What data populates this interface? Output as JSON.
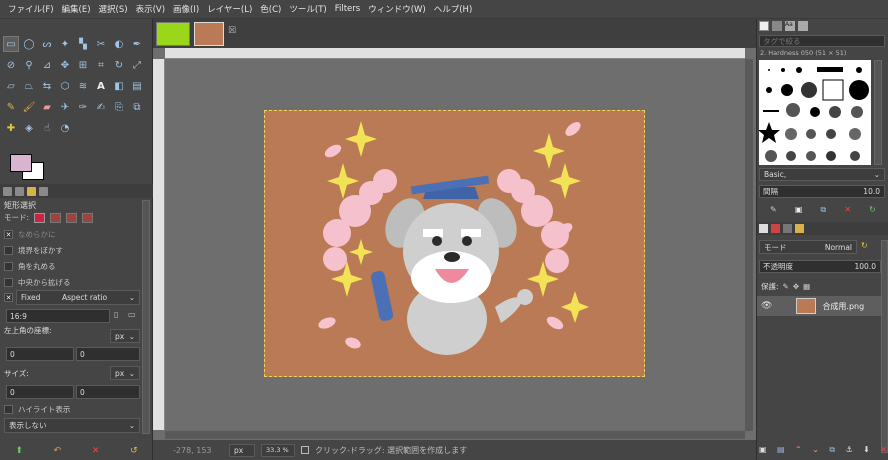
{
  "menu": [
    "ファイル(F)",
    "編集(E)",
    "選択(S)",
    "表示(V)",
    "画像(I)",
    "レイヤー(L)",
    "色(C)",
    "ツール(T)",
    "Filters",
    "ウィンドウ(W)",
    "ヘルプ(H)"
  ],
  "colors": {
    "fg": "#d8b4d0",
    "bg": "#ffffff",
    "image_bg": "#b97a55"
  },
  "tool_options": {
    "title": "矩形選択",
    "mode_label": "モード:",
    "antialias": "なめらかに",
    "feather": "境界をぼかす",
    "rounded": "角を丸める",
    "expand": "中央から拡げる",
    "fixed_label": "Fixed",
    "fixed_value": "Aspect ratio",
    "ratio": "16:9",
    "position_label": "左上角の座標:",
    "size_label": "サイズ:",
    "unit": "px",
    "pos_x": "0",
    "pos_y": "0",
    "size_w": "0",
    "size_h": "0",
    "highlight": "ハイライト表示",
    "guides": "表示しない"
  },
  "status": {
    "coords": "-278, 153",
    "unit": "px",
    "zoom": "33.3 %",
    "message": "クリック-ドラッグ: 選択範囲を作成します"
  },
  "brushes": {
    "filter_placeholder": "タグで絞る",
    "brush_name": "2. Hardness 050 (51 × 51)",
    "preset": "Basic,",
    "spacing_label": "間隔",
    "spacing_value": "10.0"
  },
  "layers": {
    "mode_label": "モード",
    "mode_value": "Normal",
    "opacity_label": "不透明度",
    "opacity_value": "100.0",
    "lock_label": "保護:",
    "layer_name": "合成用.png"
  }
}
